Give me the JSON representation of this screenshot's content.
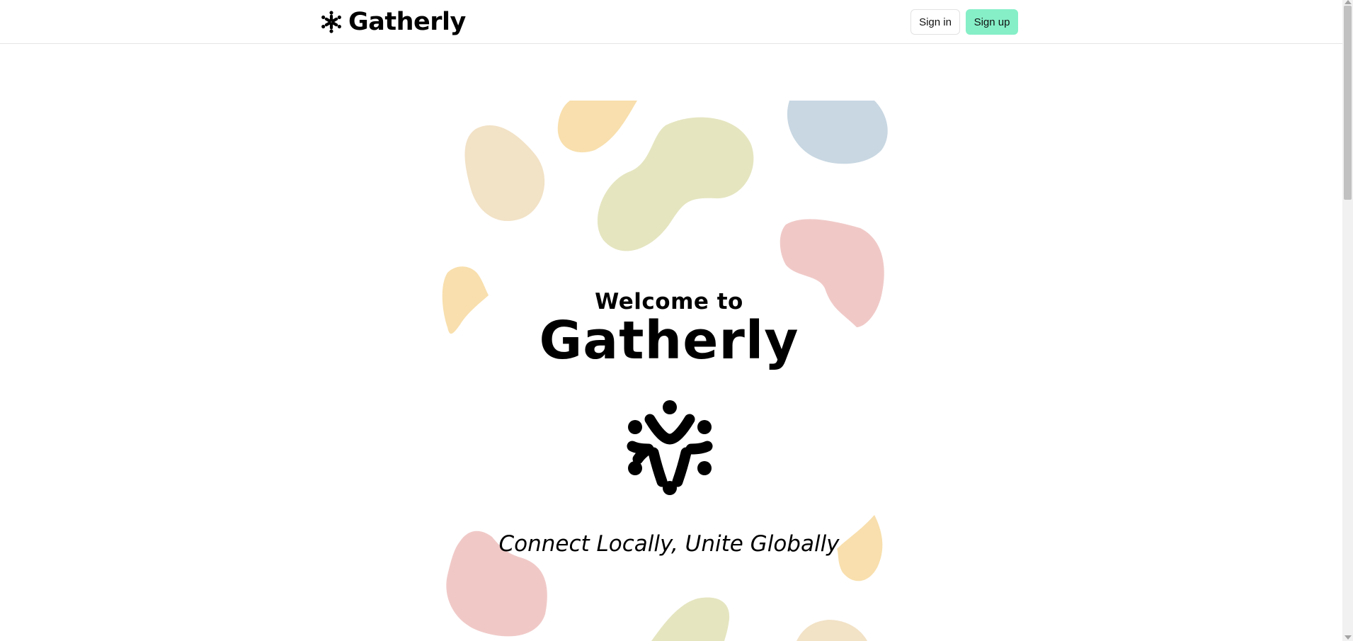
{
  "header": {
    "brand_name": "Gatherly",
    "brand_icon": "gatherly-people-circle-logo",
    "signin_label": "Sign in",
    "signup_label": "Sign up",
    "signup_color": "#86efc8"
  },
  "hero": {
    "welcome": "Welcome to",
    "title": "Gatherly",
    "logo_icon": "gatherly-people-circle-logo",
    "tagline": "Connect Locally, Unite Globally",
    "blob_colors": [
      "#f2e2c6",
      "#f8dfad",
      "#e5e5c0",
      "#c8d7e2",
      "#f0c9c7"
    ]
  }
}
